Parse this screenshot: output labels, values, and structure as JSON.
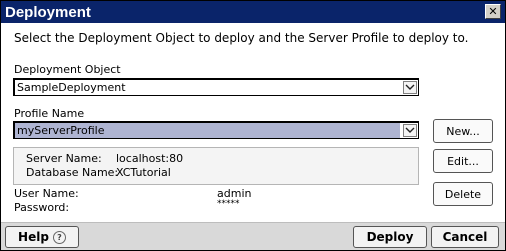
{
  "window": {
    "title": "Deployment"
  },
  "instruction": "Select the Deployment Object to deploy and the Server Profile to deploy to.",
  "deployment_object": {
    "label": "Deployment Object",
    "value": "SampleDeployment"
  },
  "profile": {
    "label": "Profile Name",
    "value": "myServerProfile"
  },
  "server_info": {
    "server_name_label": "Server Name:",
    "server_name": "localhost:80",
    "database_name_label": "Database Name:",
    "database_name": "XCTutorial"
  },
  "credentials": {
    "user_name_label": "User Name:",
    "user_name": "admin",
    "password_label": "Password:",
    "password": "*****"
  },
  "side_buttons": {
    "new": "New...",
    "edit": "Edit...",
    "delete": "Delete"
  },
  "footer": {
    "help": "Help",
    "help_icon": "?",
    "deploy": "Deploy",
    "cancel": "Cancel"
  },
  "close_glyph": "✕"
}
